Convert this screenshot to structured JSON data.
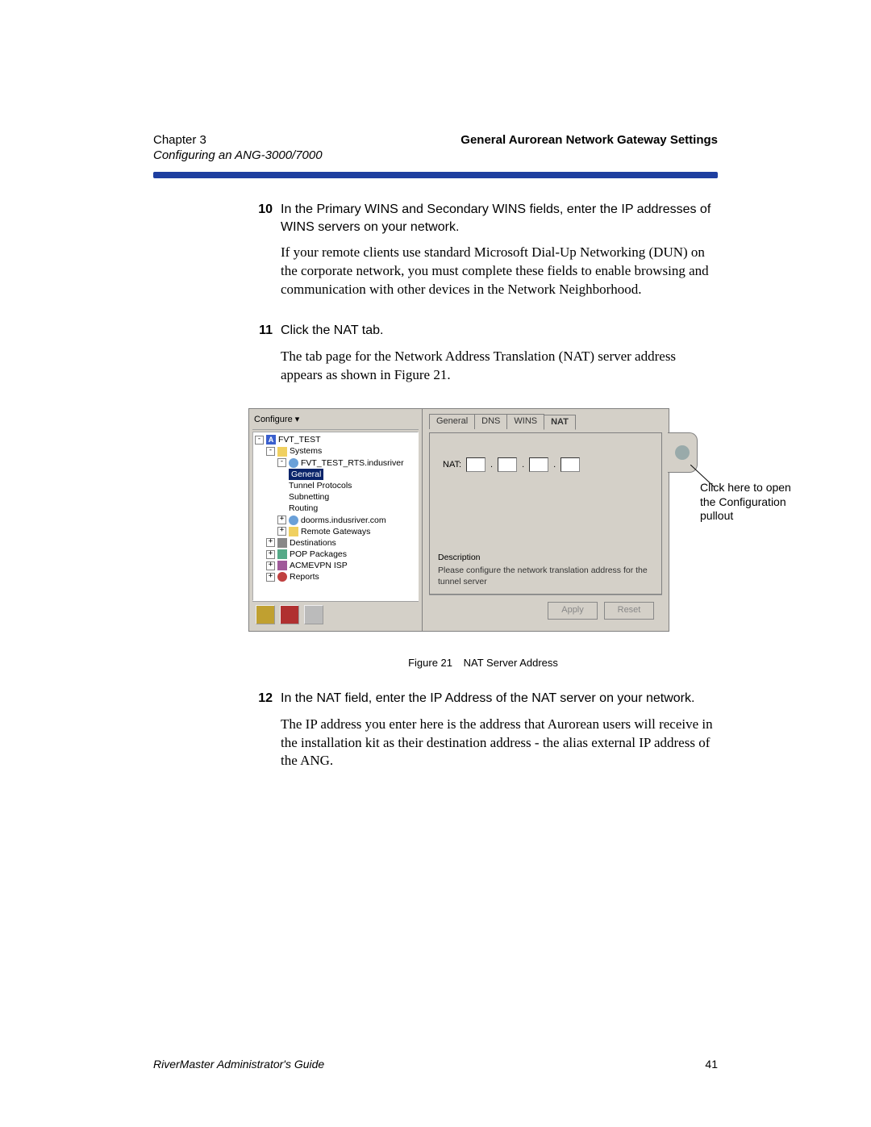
{
  "header": {
    "chapter": "Chapter 3",
    "section_title": "General Aurorean Network Gateway Settings",
    "subtitle": "Configuring an ANG-3000/7000"
  },
  "steps": {
    "s10": {
      "num": "10",
      "p1": "In the Primary WINS and Secondary WINS fields, enter the IP addresses of WINS servers on your network.",
      "p2": "If your remote clients use standard Microsoft Dial-Up Networking (DUN) on the corporate network, you must complete these fields to enable browsing and communication with other devices in the Network Neighborhood."
    },
    "s11": {
      "num": "11",
      "p1": "Click the NAT tab.",
      "p2": "The tab page for the Network Address Translation (NAT) server address appears as shown in Figure 21."
    },
    "s12": {
      "num": "12",
      "p1": "In the NAT field, enter the IP Address of the NAT server on your network.",
      "p2": "The IP address you enter here is the address that Aurorean users will receive in the installation kit as their destination address - the alias external IP address of the ANG."
    }
  },
  "screenshot": {
    "tree_header": "Configure ▾",
    "tree": {
      "root": "FVT_TEST",
      "systems": "Systems",
      "host": "FVT_TEST_RTS.indusriver",
      "items": {
        "general": "General",
        "tunnel": "Tunnel Protocols",
        "subnet": "Subnetting",
        "routing": "Routing",
        "doorms": "doorms.indusriver.com",
        "remote": "Remote Gateways"
      },
      "dest": "Destinations",
      "pop": "POP Packages",
      "isp": "ACMEVPN ISP",
      "reports": "Reports"
    },
    "tabs": {
      "general": "General",
      "dns": "DNS",
      "wins": "WINS",
      "nat": "NAT"
    },
    "nat_label": "NAT:",
    "desc_title": "Description",
    "desc_text": "Please configure the network translation address for the tunnel server",
    "buttons": {
      "apply": "Apply",
      "reset": "Reset"
    }
  },
  "callout": "Click here to open the Configuration pullout",
  "figure": {
    "label": "Figure 21",
    "caption": "NAT Server Address"
  },
  "footer": {
    "guide": "RiverMaster Administrator's Guide",
    "page": "41"
  }
}
